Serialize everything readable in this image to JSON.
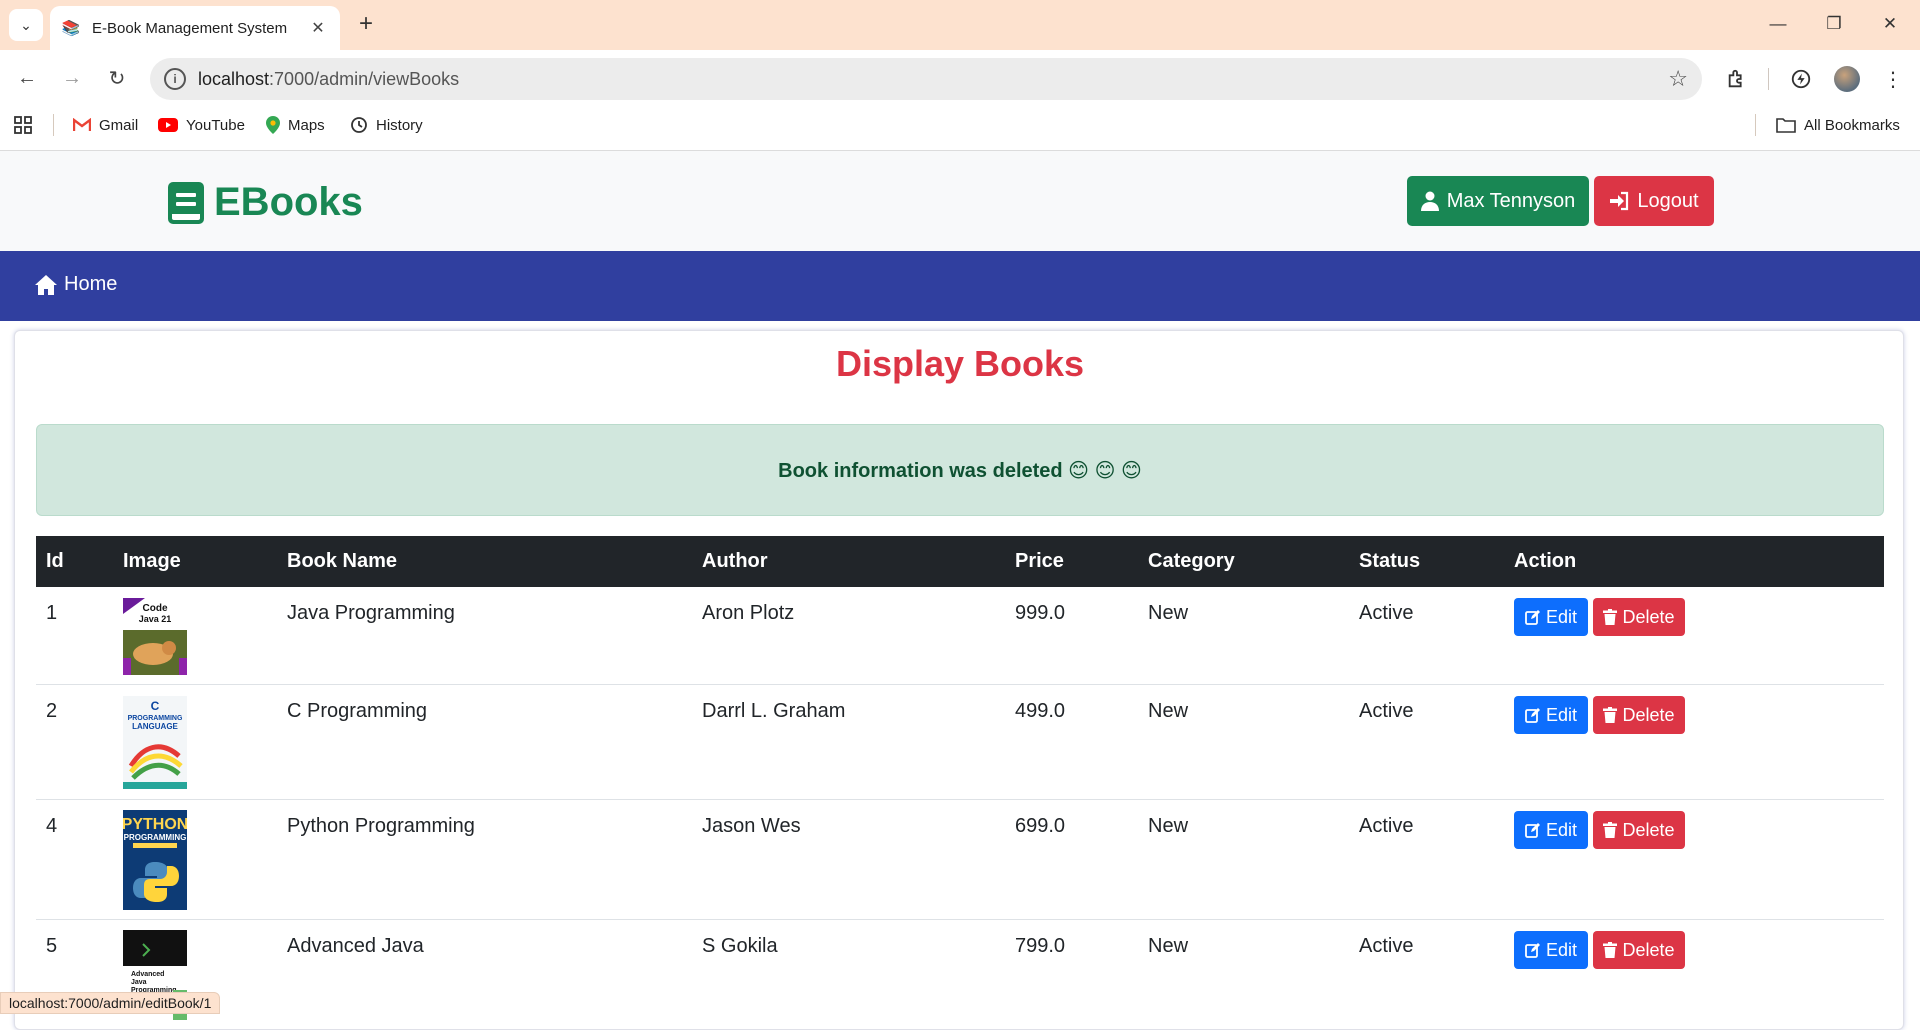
{
  "browser": {
    "tab_title": "E-Book Management System",
    "url_host": "localhost",
    "url_path": ":7000/admin/viewBooks",
    "bookmarks": [
      {
        "label": "Gmail",
        "icon": "gmail-icon"
      },
      {
        "label": "YouTube",
        "icon": "youtube-icon"
      },
      {
        "label": "Maps",
        "icon": "maps-icon"
      },
      {
        "label": "History",
        "icon": "history-icon"
      }
    ],
    "all_bookmarks_label": "All Bookmarks",
    "status_url": "localhost:7000/admin/editBook/1"
  },
  "header": {
    "brand": "EBooks",
    "user_button": "Max Tennyson",
    "logout_button": "Logout"
  },
  "nav": {
    "home": "Home"
  },
  "main": {
    "title": "Display Books",
    "alert": "Book information was deleted 😊 😊 😊",
    "columns": [
      "Id",
      "Image",
      "Book Name",
      "Author",
      "Price",
      "Category",
      "Status",
      "Action"
    ],
    "edit_label": "Edit",
    "delete_label": "Delete",
    "rows": [
      {
        "id": "1",
        "name": "Java Programming",
        "author": "Aron Plotz",
        "price": "999.0",
        "category": "New",
        "status": "Active",
        "cover_text": "Code Java 21"
      },
      {
        "id": "2",
        "name": "C Programming",
        "author": "Darrl L. Graham",
        "price": "499.0",
        "category": "New",
        "status": "Active",
        "cover_text": "C PROGRAMMING LANGUAGE"
      },
      {
        "id": "4",
        "name": "Python Programming",
        "author": "Jason Wes",
        "price": "699.0",
        "category": "New",
        "status": "Active",
        "cover_text": "PYTHON PROGRAMMING"
      },
      {
        "id": "5",
        "name": "Advanced Java",
        "author": "S Gokila",
        "price": "799.0",
        "category": "New",
        "status": "Active",
        "cover_text": "Advanced Java Programming"
      }
    ]
  },
  "colors": {
    "brand_green": "#198754",
    "nav_blue": "#303f9f",
    "danger_red": "#dc3545",
    "primary_blue": "#0d6efd",
    "alert_bg": "#d1e7dd"
  }
}
